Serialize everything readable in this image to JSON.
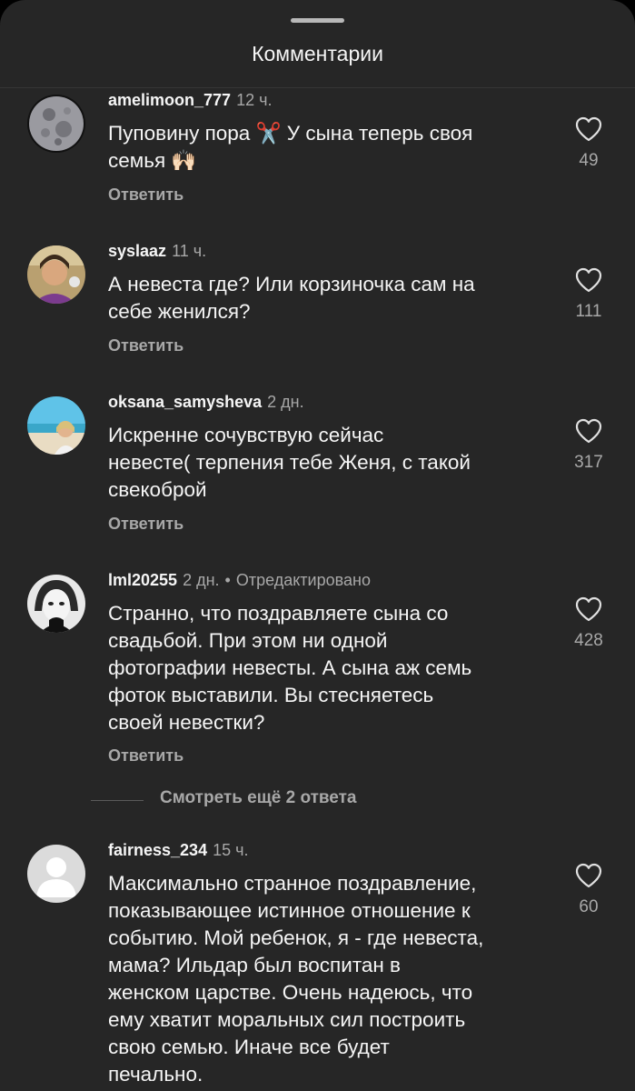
{
  "header": {
    "title": "Комментарии"
  },
  "comments": [
    {
      "username": "amelimoon_777",
      "time": "12 ч.",
      "text": "Пуповину пора ✂️ У сына теперь своя\nсемья 🙌🏻",
      "reply_label": "Ответить",
      "likes": "49",
      "avatar": "moon-avatar"
    },
    {
      "username": "syslaaz",
      "time": "11 ч.",
      "text": "А невеста где? Или корзиночка сам на\nсебе женился?",
      "reply_label": "Ответить",
      "likes": "111",
      "avatar": "user-photo-avatar"
    },
    {
      "username": "oksana_samysheva",
      "time": "2 дн.",
      "text": "Искренне сочувствую сейчас\nневесте( терпения тебе Женя, с такой\nсвекоброй",
      "reply_label": "Ответить",
      "likes": "317",
      "avatar": "beach-photo-avatar"
    },
    {
      "username": "lml20255",
      "time": "2 дн.",
      "separator": "•",
      "edited": "Отредактировано",
      "text": "Странно, что поздравляете сына со\nсвадьбой.  При этом ни одной\nфотографии невесты. А сына аж семь\nфоток выставили. Вы стесняетесь\nсвоей невестки?",
      "reply_label": "Ответить",
      "likes": "428",
      "avatar": "portrait-photo-avatar"
    },
    {
      "username": "fairness_234",
      "time": "15 ч.",
      "text": "Максимально странное поздравление,\nпоказывающее истинное отношение к\nсобытию. Мой ребенок, я - где невеста,\nмама? Ильдар был воспитан в\nженском царстве.  Очень надеюсь, что\nему хватит моральных сил построить\nсвою семью. Иначе все будет\nпечально.",
      "likes": "60",
      "avatar": "default-avatar"
    }
  ],
  "view_more_replies": "Смотреть ещё 2 ответа",
  "colors": {
    "sheet_background": "#262626",
    "primary_text": "#f5f5f5",
    "secondary_text": "#a8a8a8"
  }
}
